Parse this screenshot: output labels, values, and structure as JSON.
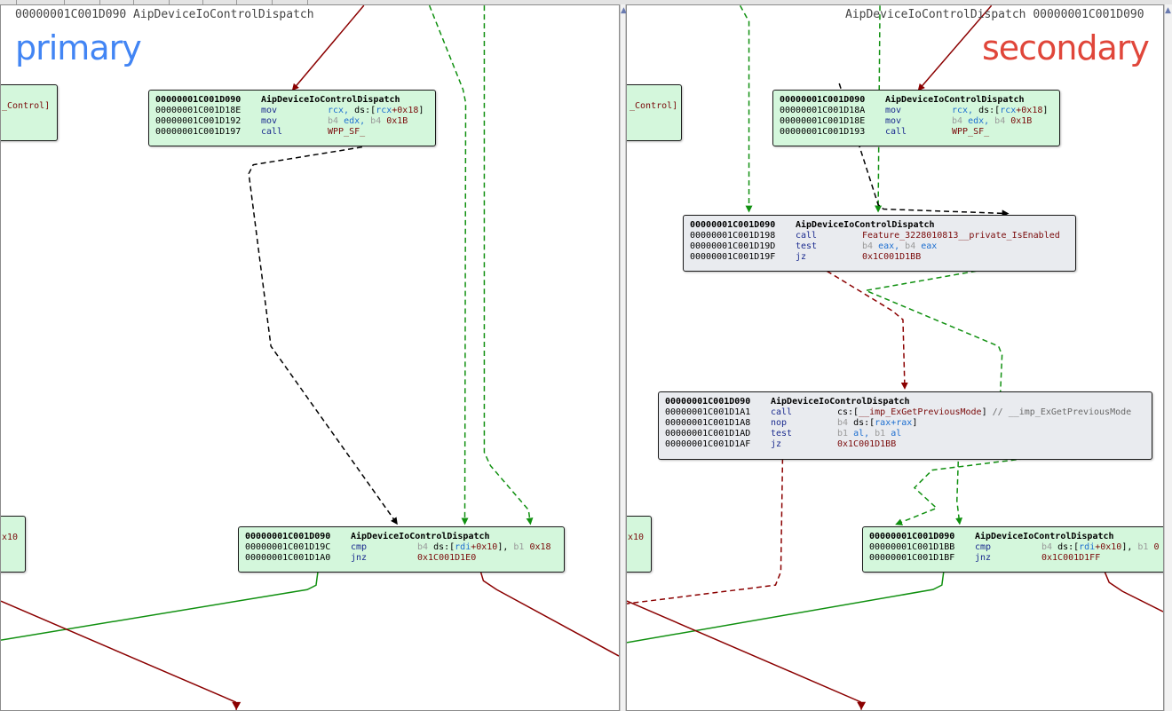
{
  "colors": {
    "primary_label": "#4285f4",
    "secondary_label": "#e0463a",
    "node_green": "#d4f7dc",
    "node_gray": "#e9ebef",
    "edge_red": "#8b0000",
    "edge_green": "#109010",
    "edge_black": "#000000"
  },
  "left": {
    "header": "00000001C001D090 AipDeviceIoControlDispatch",
    "label": "primary",
    "partial_node_top": "_Control]",
    "partial_node_bottom": "x10",
    "node_a": {
      "header_addr": "00000001C001D090",
      "header_func": "AipDeviceIoControlDispatch",
      "r1_addr": "00000001C001D18E",
      "r1_mn": "mov",
      "r1_reg": "rcx,",
      "r1_seg": " ds:[",
      "r1_reg2": "rcx",
      "r1_off": "+0x18",
      "r1_close": "]",
      "r2_addr": "00000001C001D192",
      "r2_mn": "mov",
      "r2_pre1": "b4",
      "r2_reg": " edx,",
      "r2_pre2": " b4",
      "r2_num": " 0x1B",
      "r3_addr": "00000001C001D197",
      "r3_mn": "call",
      "r3_op": "WPP_SF_"
    },
    "node_b": {
      "header_addr": "00000001C001D090",
      "header_func": "AipDeviceIoControlDispatch",
      "r1_addr": "00000001C001D19C",
      "r1_mn": "cmp",
      "r1_pre": "b4",
      "r1_seg": " ds:[",
      "r1_reg": "rdi",
      "r1_off": "+0x10",
      "r1_close": "],",
      "r1_pre2": " b1",
      "r1_num": " 0x18",
      "r2_addr": "00000001C001D1A0",
      "r2_mn": "jnz",
      "r2_op": "0x1C001D1E0"
    }
  },
  "right": {
    "header": "AipDeviceIoControlDispatch 00000001C001D090",
    "label": "secondary",
    "partial_node_top": "_Control]",
    "partial_node_bottom": "x10",
    "node_a": {
      "header_addr": "00000001C001D090",
      "header_func": "AipDeviceIoControlDispatch",
      "r1_addr": "00000001C001D18A",
      "r1_mn": "mov",
      "r1_reg": "rcx,",
      "r1_seg": " ds:[",
      "r1_reg2": "rcx",
      "r1_off": "+0x18",
      "r1_close": "]",
      "r2_addr": "00000001C001D18E",
      "r2_mn": "mov",
      "r2_pre1": "b4",
      "r2_reg": " edx,",
      "r2_pre2": " b4",
      "r2_num": " 0x1B",
      "r3_addr": "00000001C001D193",
      "r3_mn": "call",
      "r3_op": "WPP_SF_"
    },
    "node_c": {
      "header_addr": "00000001C001D090",
      "header_func": "AipDeviceIoControlDispatch",
      "r1_addr": "00000001C001D198",
      "r1_mn": "call",
      "r1_op": "Feature_3228010813__private_IsEnabled",
      "r2_addr": "00000001C001D19D",
      "r2_mn": "test",
      "r2_pre1": "b4",
      "r2_reg1": " eax,",
      "r2_pre2": " b4",
      "r2_reg2": " eax",
      "r3_addr": "00000001C001D19F",
      "r3_mn": "jz",
      "r3_op": "0x1C001D1BB"
    },
    "node_d": {
      "header_addr": "00000001C001D090",
      "header_func": "AipDeviceIoControlDispatch",
      "r1_addr": "00000001C001D1A1",
      "r1_mn": "call",
      "r1_seg": "cs:[",
      "r1_op": "__imp_ExGetPreviousMode",
      "r1_close": "]",
      "r1_cmt": " // __imp_ExGetPreviousMode",
      "r2_addr": "00000001C001D1A8",
      "r2_mn": "nop",
      "r2_pre": "b4",
      "r2_seg": " ds:[",
      "r2_reg": "rax+rax",
      "r2_close": "]",
      "r3_addr": "00000001C001D1AD",
      "r3_mn": "test",
      "r3_pre1": "b1",
      "r3_reg1": " al,",
      "r3_pre2": " b1",
      "r3_reg2": " al",
      "r4_addr": "00000001C001D1AF",
      "r4_mn": "jz",
      "r4_op": "0x1C001D1BB"
    },
    "node_b": {
      "header_addr": "00000001C001D090",
      "header_func": "AipDeviceIoControlDispatch",
      "r1_addr": "00000001C001D1BB",
      "r1_mn": "cmp",
      "r1_pre": "b4",
      "r1_seg": " ds:[",
      "r1_reg": "rdi",
      "r1_off": "+0x10",
      "r1_close": "],",
      "r1_pre2": " b1",
      "r1_num": " 0",
      "r2_addr": "00000001C001D1BF",
      "r2_mn": "jnz",
      "r2_op": "0x1C001D1FF"
    }
  }
}
